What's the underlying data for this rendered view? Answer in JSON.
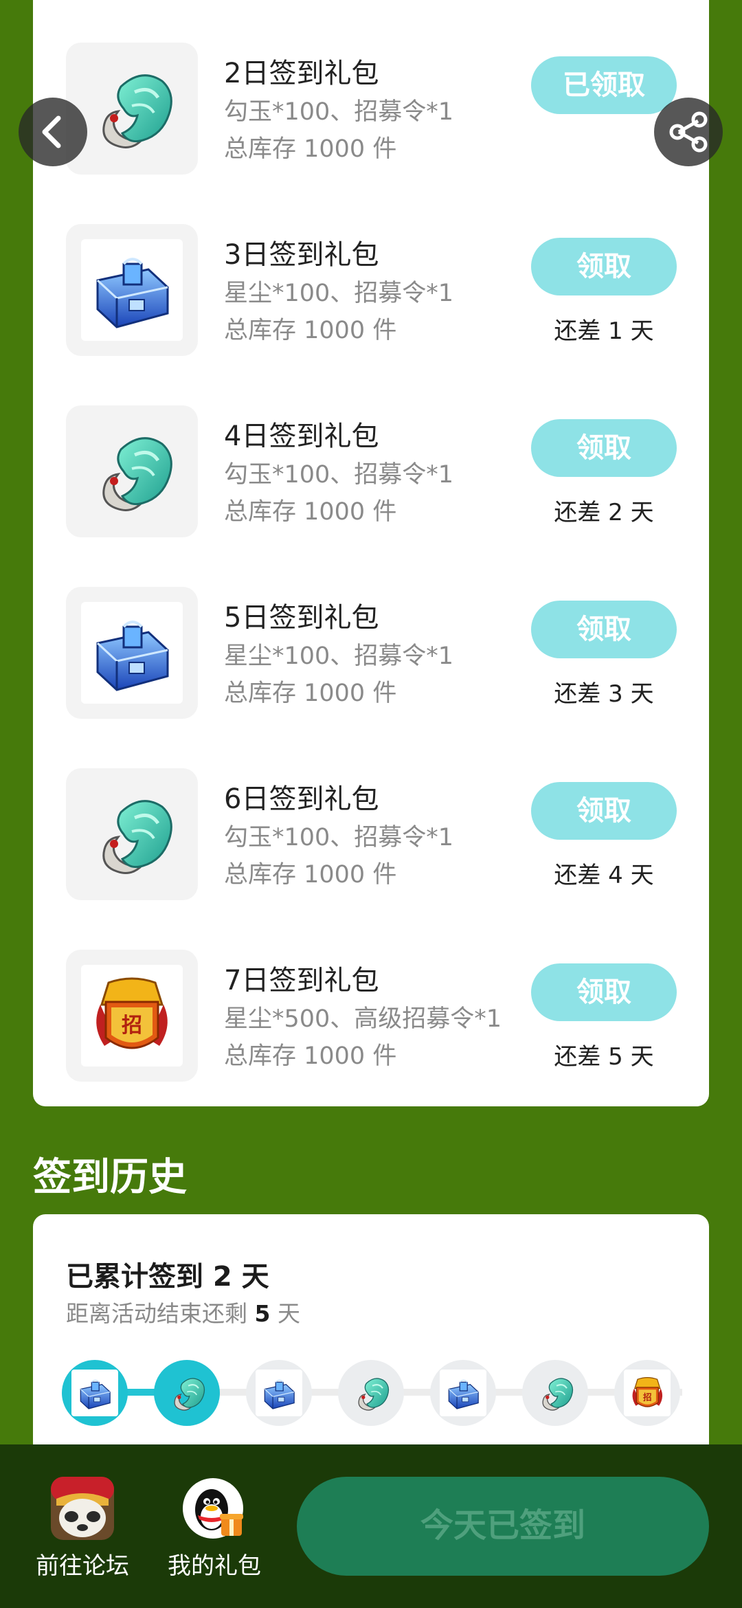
{
  "gifts": [
    {
      "title": "2日签到礼包",
      "content": "勾玉*100、招募令*1",
      "stock": "总库存 1000 件",
      "button": "已领取",
      "remain": "",
      "icon": "jade-icon"
    },
    {
      "title": "3日签到礼包",
      "content": "星尘*100、招募令*1",
      "stock": "总库存 1000 件",
      "button": "领取",
      "remain": "还差 1 天",
      "icon": "chest-icon"
    },
    {
      "title": "4日签到礼包",
      "content": "勾玉*100、招募令*1",
      "stock": "总库存 1000 件",
      "button": "领取",
      "remain": "还差 2 天",
      "icon": "jade-icon"
    },
    {
      "title": "5日签到礼包",
      "content": "星尘*100、招募令*1",
      "stock": "总库存 1000 件",
      "button": "领取",
      "remain": "还差 3 天",
      "icon": "chest-icon"
    },
    {
      "title": "6日签到礼包",
      "content": "勾玉*100、招募令*1",
      "stock": "总库存 1000 件",
      "button": "领取",
      "remain": "还差 4 天",
      "icon": "jade-icon"
    },
    {
      "title": "7日签到礼包",
      "content": "星尘*500、高级招募令*1",
      "stock": "总库存 1000 件",
      "button": "领取",
      "remain": "还差 5 天",
      "icon": "recruit-token-icon"
    }
  ],
  "history": {
    "title": "签到历史",
    "summary": "已累计签到 2 天",
    "countdown_prefix": "距离活动结束还剩 ",
    "countdown_days": "5",
    "countdown_suffix": " 天",
    "signed_days": 2,
    "total_days": 7,
    "days": [
      {
        "icon": "chest-icon",
        "done": true
      },
      {
        "icon": "jade-icon",
        "done": true
      },
      {
        "icon": "chest-icon",
        "done": false
      },
      {
        "icon": "jade-icon",
        "done": false
      },
      {
        "icon": "chest-icon",
        "done": false
      },
      {
        "icon": "jade-icon",
        "done": false
      },
      {
        "icon": "recruit-token-icon",
        "done": false
      }
    ]
  },
  "bottom_bar": {
    "forum_label": "前往论坛",
    "my_gifts_label": "我的礼包",
    "signed_button": "今天已签到"
  },
  "colors": {
    "background": "#467a0b",
    "claim_button": "#8ee2e6",
    "progress": "#1fc2d2",
    "signed_button": "#1e7e55"
  }
}
